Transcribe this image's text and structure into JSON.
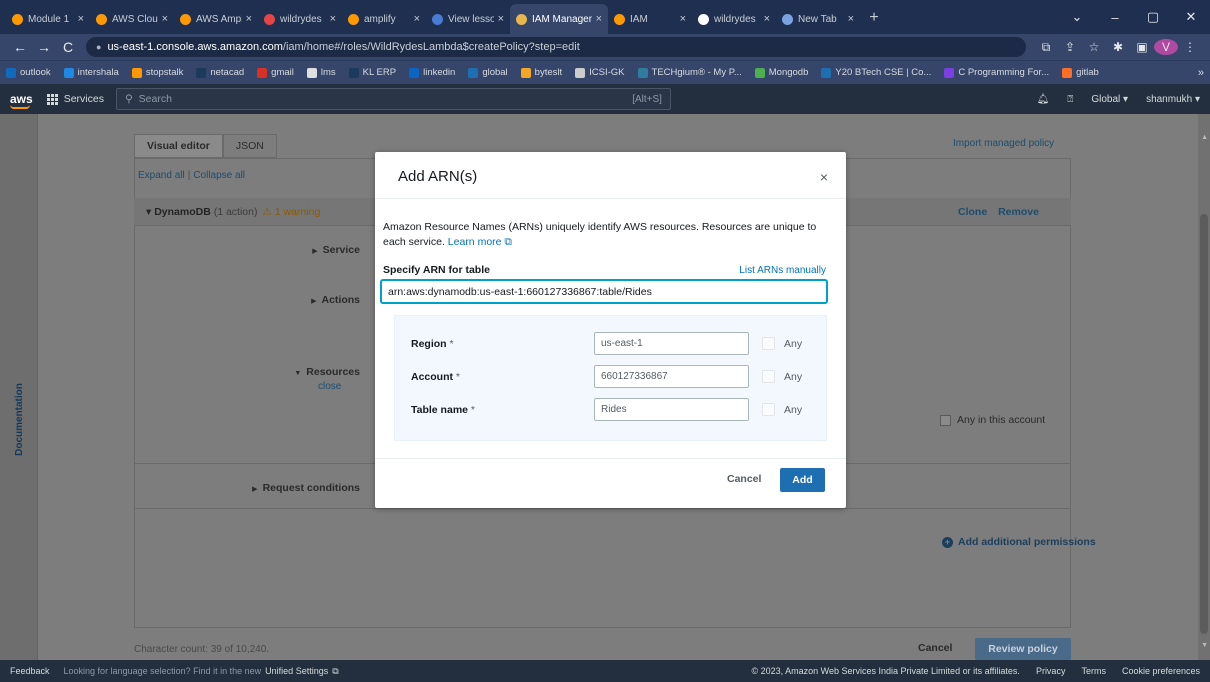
{
  "browser": {
    "tabs": [
      {
        "label": "Module 1",
        "color": "#ff9900"
      },
      {
        "label": "AWS Cloud",
        "color": "#ff9900"
      },
      {
        "label": "AWS Amplify",
        "color": "#ff9900"
      },
      {
        "label": "wildrydes",
        "color": "#e64545"
      },
      {
        "label": "amplify",
        "color": "#ff9900"
      },
      {
        "label": "View lesson",
        "color": "#4a7bd4"
      },
      {
        "label": "IAM Management",
        "color": "#e8b64a",
        "active": true
      },
      {
        "label": "IAM",
        "color": "#ff9900"
      },
      {
        "label": "wildrydes",
        "color": "#ffffff"
      },
      {
        "label": "New Tab",
        "color": "#7aa2e0"
      }
    ],
    "new_tab": "+",
    "window_controls": [
      "⌄",
      "–",
      "▢",
      "✕"
    ],
    "nav": {
      "back": "←",
      "forward": "→",
      "reload": "C"
    },
    "url_host": "us-east-1.console.aws.amazon.com",
    "url_path": "/iam/home#/roles/WildRydesLambda$createPolicy?step=edit",
    "profile_initial": "V",
    "bookmarks": [
      {
        "label": "outlook",
        "color": "#0f6cbd"
      },
      {
        "label": "intershala",
        "color": "#1e88e5"
      },
      {
        "label": "stopstalk",
        "color": "#ff9800"
      },
      {
        "label": "netacad",
        "color": "#1b3a5c"
      },
      {
        "label": "gmail",
        "color": "#d93025"
      },
      {
        "label": "lms",
        "color": "#e0e0e0"
      },
      {
        "label": "KL ERP",
        "color": "#1b3a5c"
      },
      {
        "label": "linkedin",
        "color": "#0a66c2"
      },
      {
        "label": "global",
        "color": "#1e6fb2"
      },
      {
        "label": "byteslt",
        "color": "#f5a623"
      },
      {
        "label": "ICSI-GK",
        "color": "#cccccc"
      },
      {
        "label": "TECHgium® - My P...",
        "color": "#2e7d9e"
      },
      {
        "label": "Mongodb",
        "color": "#4caf50"
      },
      {
        "label": "Y20 BTech CSE | Co...",
        "color": "#1e6fb2"
      },
      {
        "label": "C Programming For...",
        "color": "#7b3fe4"
      },
      {
        "label": "gitlab",
        "color": "#fc6d26"
      }
    ],
    "bookmarks_more": "»"
  },
  "aws_nav": {
    "logo": "aws",
    "services": "Services",
    "search_placeholder": "Search",
    "search_shortcut": "[Alt+S]",
    "region": "Global ▾",
    "user": "shanmukh ▾"
  },
  "console": {
    "doc_label": "Documentation",
    "tab_visual": "Visual editor",
    "tab_json": "JSON",
    "import_link": "Import managed policy",
    "expand_all": "Expand all",
    "collapse_all": "Collapse all",
    "service_title": "DynamoDB",
    "service_count": "(1 action)",
    "service_warning": "⚠ 1 warning",
    "clone": "Clone",
    "remove": "Remove",
    "row_service": "Service",
    "row_actions": "Actions",
    "row_resources": "Resources",
    "row_resources_close": "close",
    "row_request": "Request conditions",
    "any_in_account": "Any in this account",
    "add_permissions": "Add additional permissions",
    "char_count": "Character count: 39 of 10,240.",
    "cancel": "Cancel",
    "review": "Review policy"
  },
  "footer": {
    "feedback": "Feedback",
    "language_note": "Looking for language selection? Find it in the new",
    "unified": "Unified Settings",
    "copyright": "© 2023, Amazon Web Services India Private Limited or its affiliates.",
    "privacy": "Privacy",
    "terms": "Terms",
    "cookies": "Cookie preferences"
  },
  "modal": {
    "title": "Add ARN(s)",
    "close": "×",
    "description": "Amazon Resource Names (ARNs) uniquely identify AWS resources. Resources are unique to each service.",
    "learn_more": "Learn more",
    "arn_label": "Specify ARN for table",
    "list_manually": "List ARNs manually",
    "arn_value": "arn:aws:dynamodb:us-east-1:660127336867:table/Rides",
    "fields": [
      {
        "label": "Region",
        "value": "us-east-1",
        "any": "Any"
      },
      {
        "label": "Account",
        "value": "660127336867",
        "any": "Any"
      },
      {
        "label": "Table name",
        "value": "Rides",
        "any": "Any"
      }
    ],
    "required_mark": "*",
    "cancel": "Cancel",
    "add": "Add"
  }
}
